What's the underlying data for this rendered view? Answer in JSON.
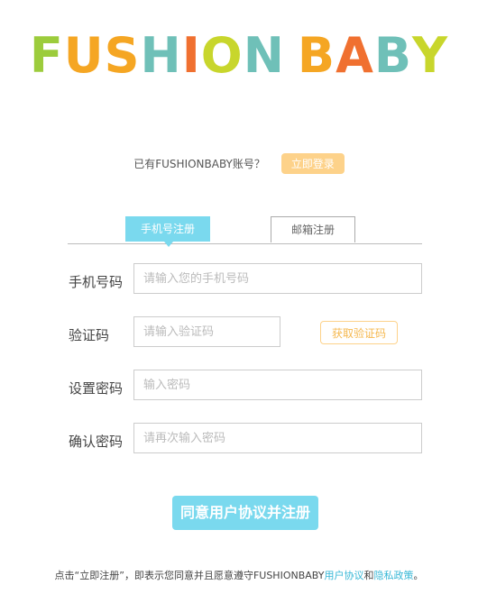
{
  "logo": {
    "letters": [
      {
        "ch": "F",
        "color": "#9ccc3c"
      },
      {
        "ch": "U",
        "color": "#f5a623"
      },
      {
        "ch": "S",
        "color": "#f5a623"
      },
      {
        "ch": "H",
        "color": "#6fc0b8"
      },
      {
        "ch": "I",
        "color": "#f07030"
      },
      {
        "ch": "O",
        "color": "#c8d62c"
      },
      {
        "ch": "N",
        "color": "#6fc0b8"
      },
      {
        "ch": " ",
        "color": "#ffffff"
      },
      {
        "ch": "B",
        "color": "#f5a623"
      },
      {
        "ch": "A",
        "color": "#f07030"
      },
      {
        "ch": "B",
        "color": "#6fc0b8"
      },
      {
        "ch": "Y",
        "color": "#c8d62c"
      }
    ]
  },
  "login": {
    "question": "已有FUSHIONBABY账号？",
    "button": "立即登录"
  },
  "tabs": {
    "phone": "手机号注册",
    "email": "邮箱注册"
  },
  "form": {
    "phone_label": "手机号码",
    "phone_placeholder": "请输入您的手机号码",
    "code_label": "验证码",
    "code_placeholder": "请输入验证码",
    "get_code": "获取验证码",
    "password_label": "设置密码",
    "password_placeholder": "输入密码",
    "confirm_label": "确认密码",
    "confirm_placeholder": "请再次输入密码"
  },
  "submit": "同意用户协议并注册",
  "footer": {
    "prefix": "点击“立即注册”，即表示您同意并且愿意遵守FUSHIONBABY",
    "agreement": "用户协议",
    "and": "和",
    "privacy": "隐私政策",
    "suffix": "。"
  },
  "colors": {
    "accent": "#7ad9ee",
    "orange": "#fdd28a",
    "link": "#36b7d6"
  }
}
